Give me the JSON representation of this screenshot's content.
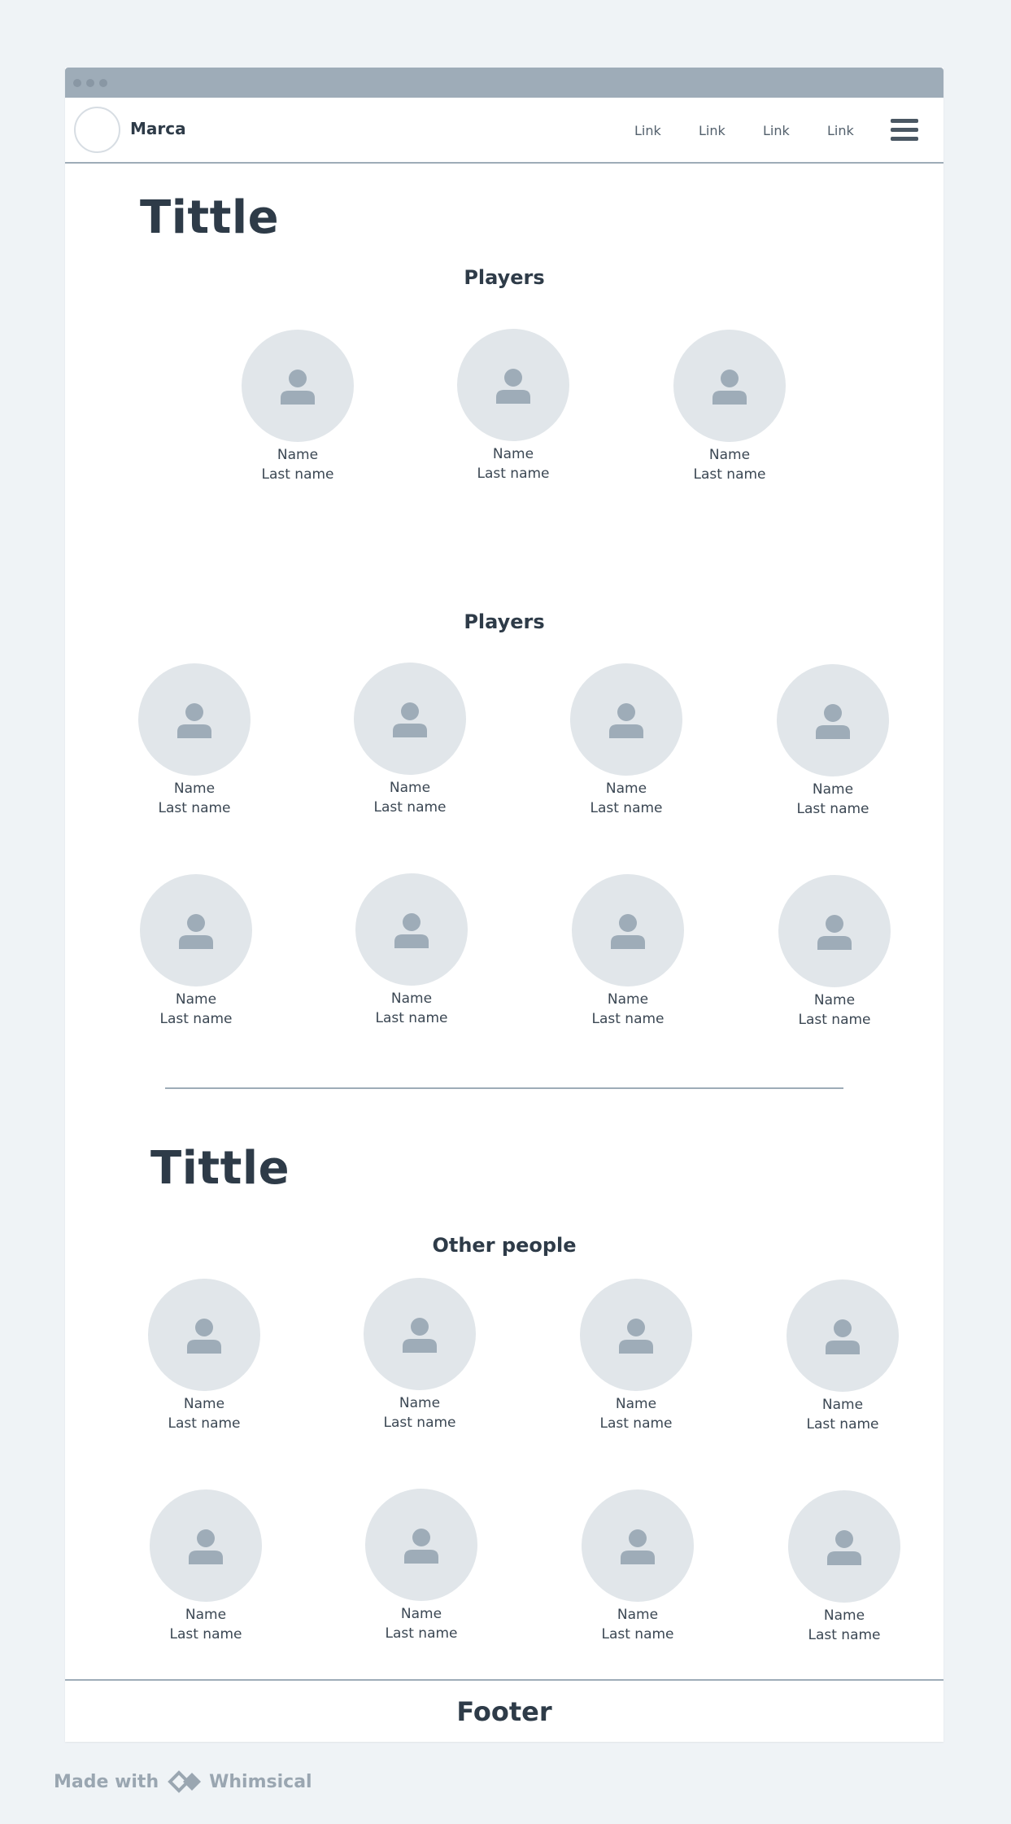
{
  "navbar": {
    "brand": "Marca",
    "links": [
      "Link",
      "Link",
      "Link",
      "Link"
    ]
  },
  "section1": {
    "title": "Tittle",
    "group1": {
      "heading": "Players",
      "people": [
        {
          "name": "Name",
          "last": "Last name"
        },
        {
          "name": "Name",
          "last": "Last name"
        },
        {
          "name": "Name",
          "last": "Last name"
        }
      ]
    },
    "group2": {
      "heading": "Players",
      "people": [
        {
          "name": "Name",
          "last": "Last name"
        },
        {
          "name": "Name",
          "last": "Last name"
        },
        {
          "name": "Name",
          "last": "Last name"
        },
        {
          "name": "Name",
          "last": "Last name"
        },
        {
          "name": "Name",
          "last": "Last name"
        },
        {
          "name": "Name",
          "last": "Last name"
        },
        {
          "name": "Name",
          "last": "Last name"
        },
        {
          "name": "Name",
          "last": "Last name"
        }
      ]
    }
  },
  "section2": {
    "title": "Tittle",
    "group": {
      "heading": "Other people",
      "people": [
        {
          "name": "Name",
          "last": "Last name"
        },
        {
          "name": "Name",
          "last": "Last name"
        },
        {
          "name": "Name",
          "last": "Last name"
        },
        {
          "name": "Name",
          "last": "Last name"
        },
        {
          "name": "Name",
          "last": "Last name"
        },
        {
          "name": "Name",
          "last": "Last name"
        },
        {
          "name": "Name",
          "last": "Last name"
        },
        {
          "name": "Name",
          "last": "Last name"
        }
      ]
    }
  },
  "footer": {
    "label": "Footer"
  },
  "watermark": {
    "prefix": "Made with",
    "brand": "Whimsical"
  },
  "colors": {
    "accent": "#9eacb8",
    "avatar_bg": "#e1e6ea",
    "avatar_icon": "#9eacb8",
    "text": "#2e3b48"
  },
  "icons": {
    "avatar": "user-icon",
    "menu": "hamburger-menu-icon"
  }
}
